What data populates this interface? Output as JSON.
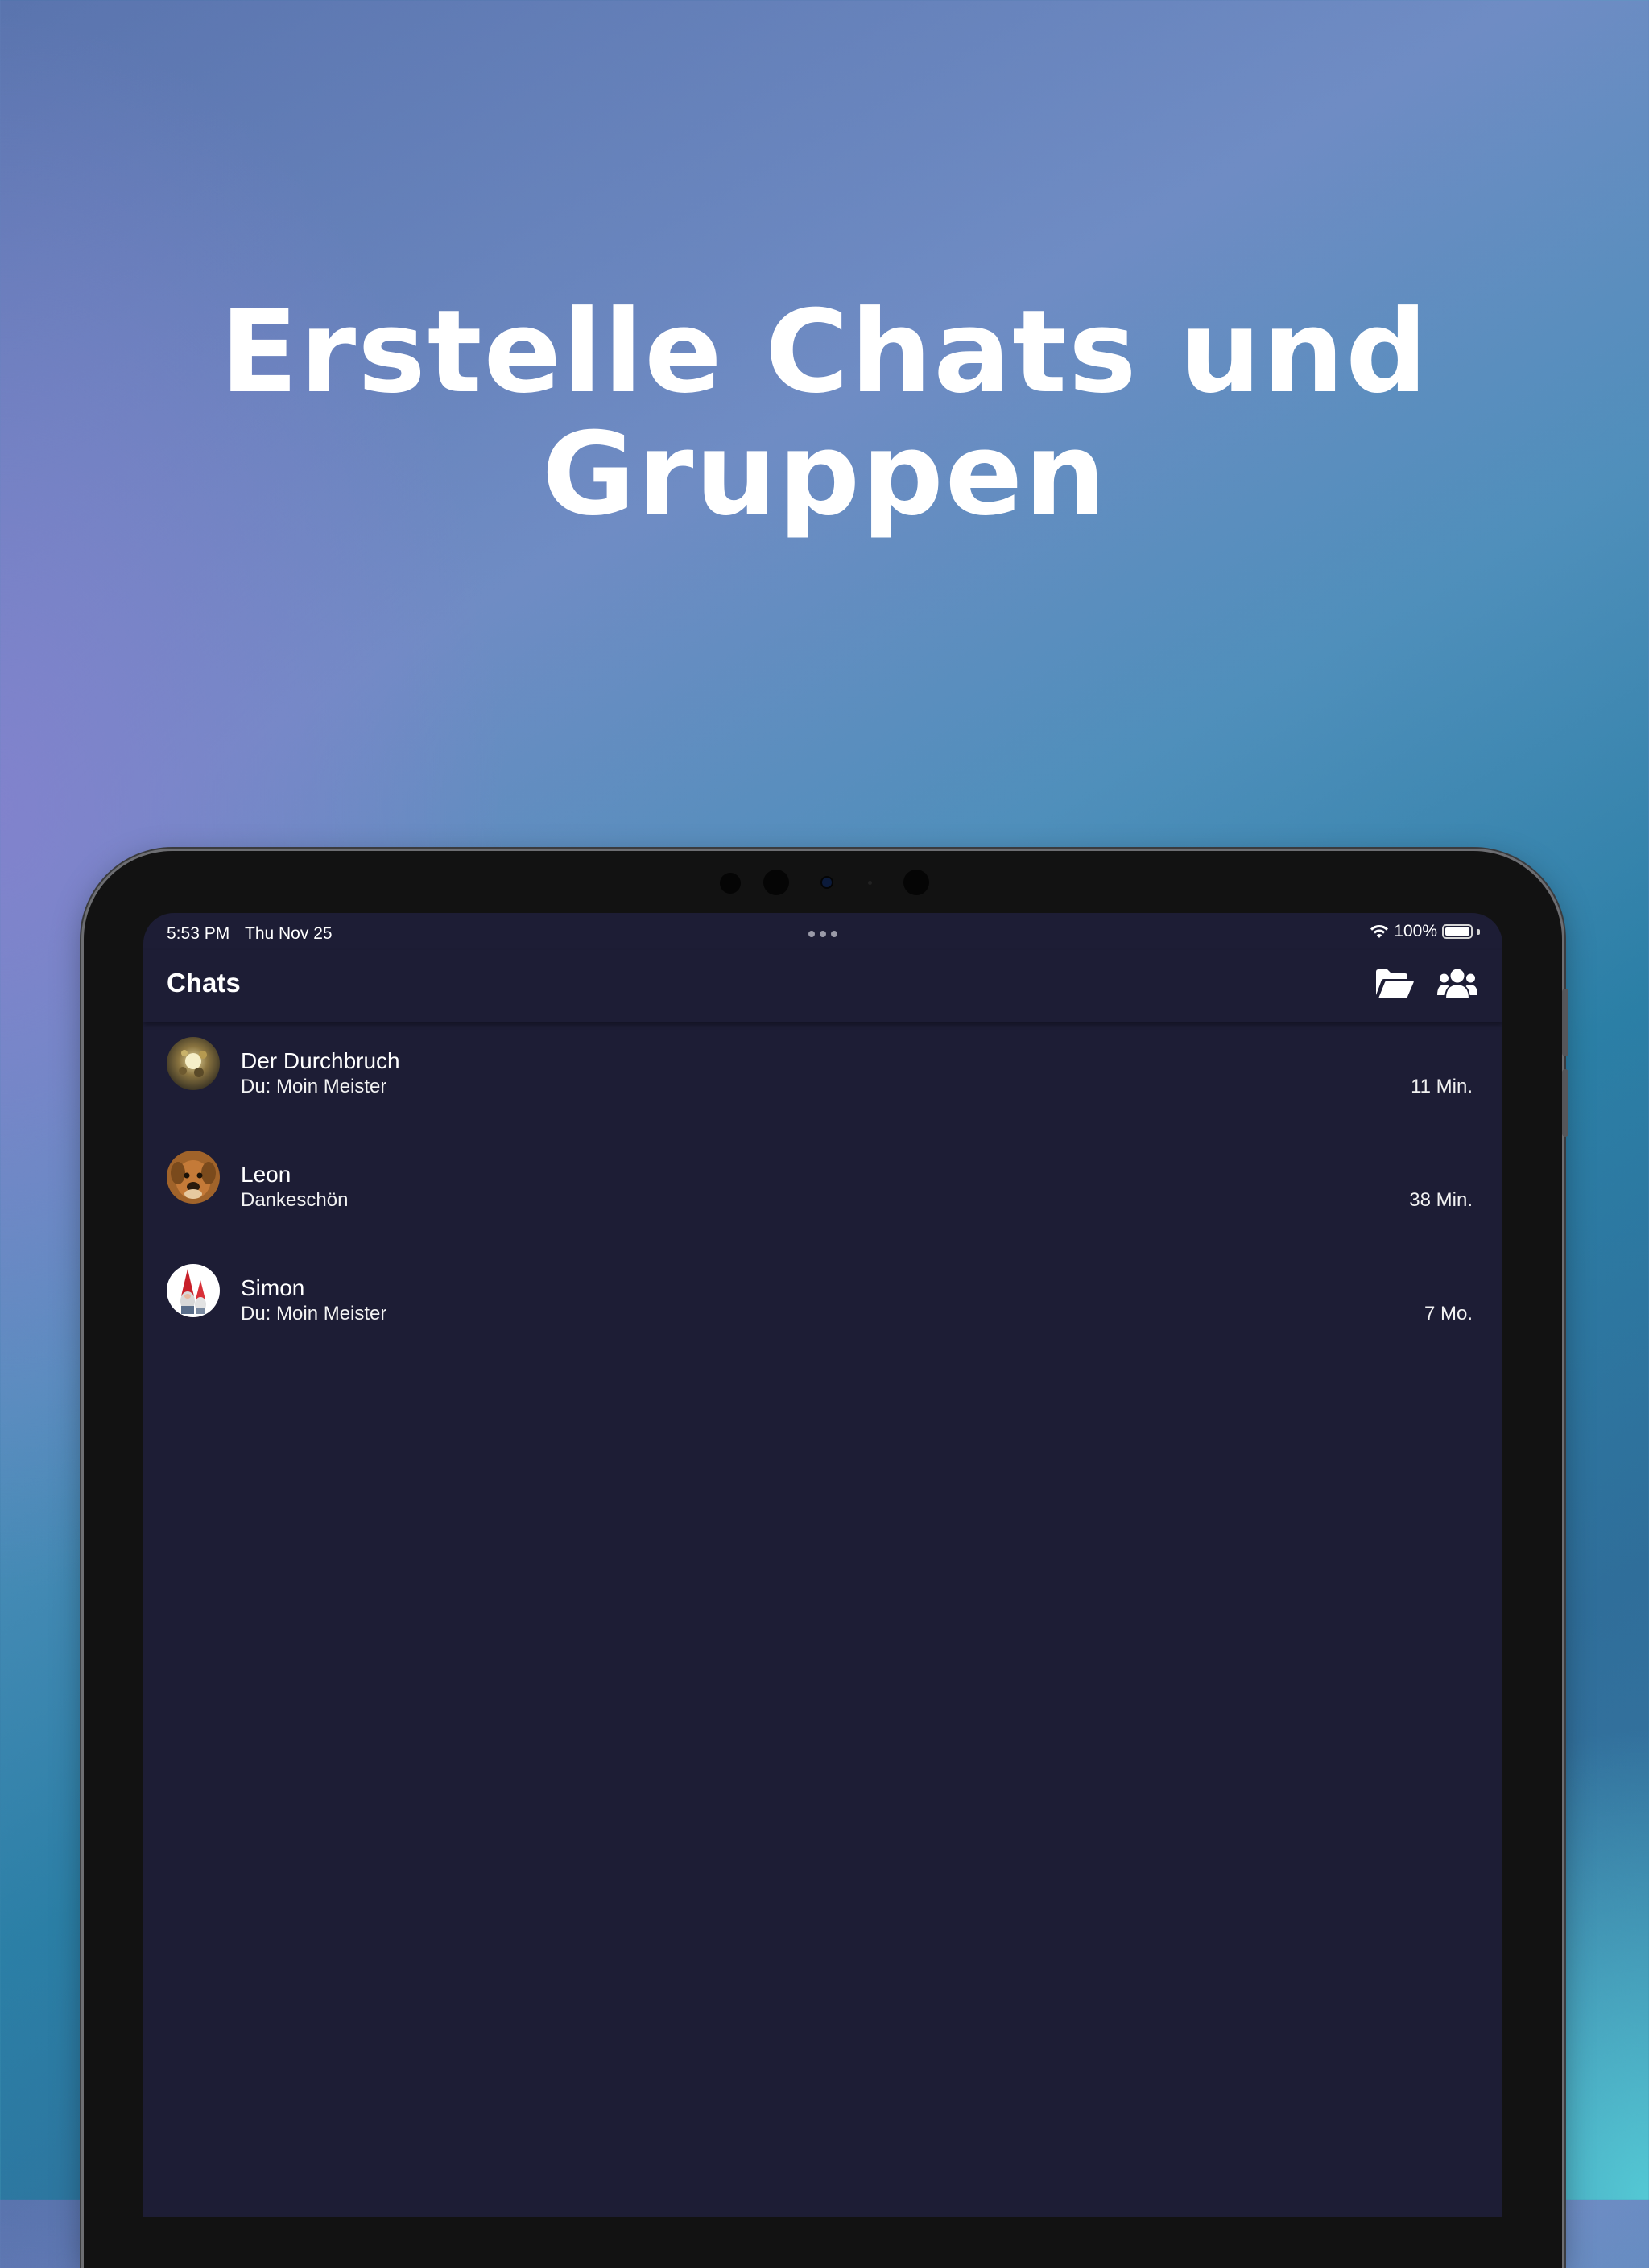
{
  "hero": {
    "line1": "Erstelle Chats und",
    "line2": "Gruppen"
  },
  "status_bar": {
    "time": "5:53 PM",
    "date": "Thu Nov 25",
    "battery": "100%",
    "battery_level": 1.0,
    "icons": [
      "wifi-icon",
      "battery-icon"
    ]
  },
  "app_bar": {
    "title": "Chats",
    "actions": [
      "folder-open-icon",
      "group-icon"
    ]
  },
  "chats": [
    {
      "name": "Der Durchbruch",
      "preview": "Du: Moin Meister",
      "time": "11 Min.",
      "avatar": "avatar-durchbruch"
    },
    {
      "name": "Leon",
      "preview": "Dankeschön",
      "time": "38 Min.",
      "avatar": "avatar-leon"
    },
    {
      "name": "Simon",
      "preview": "Du: Moin Meister",
      "time": "7 Mo.",
      "avatar": "avatar-simon"
    }
  ],
  "colors": {
    "screen_background": "#1d1d35",
    "text": "#ffffff",
    "device_bezel": "#121212"
  }
}
